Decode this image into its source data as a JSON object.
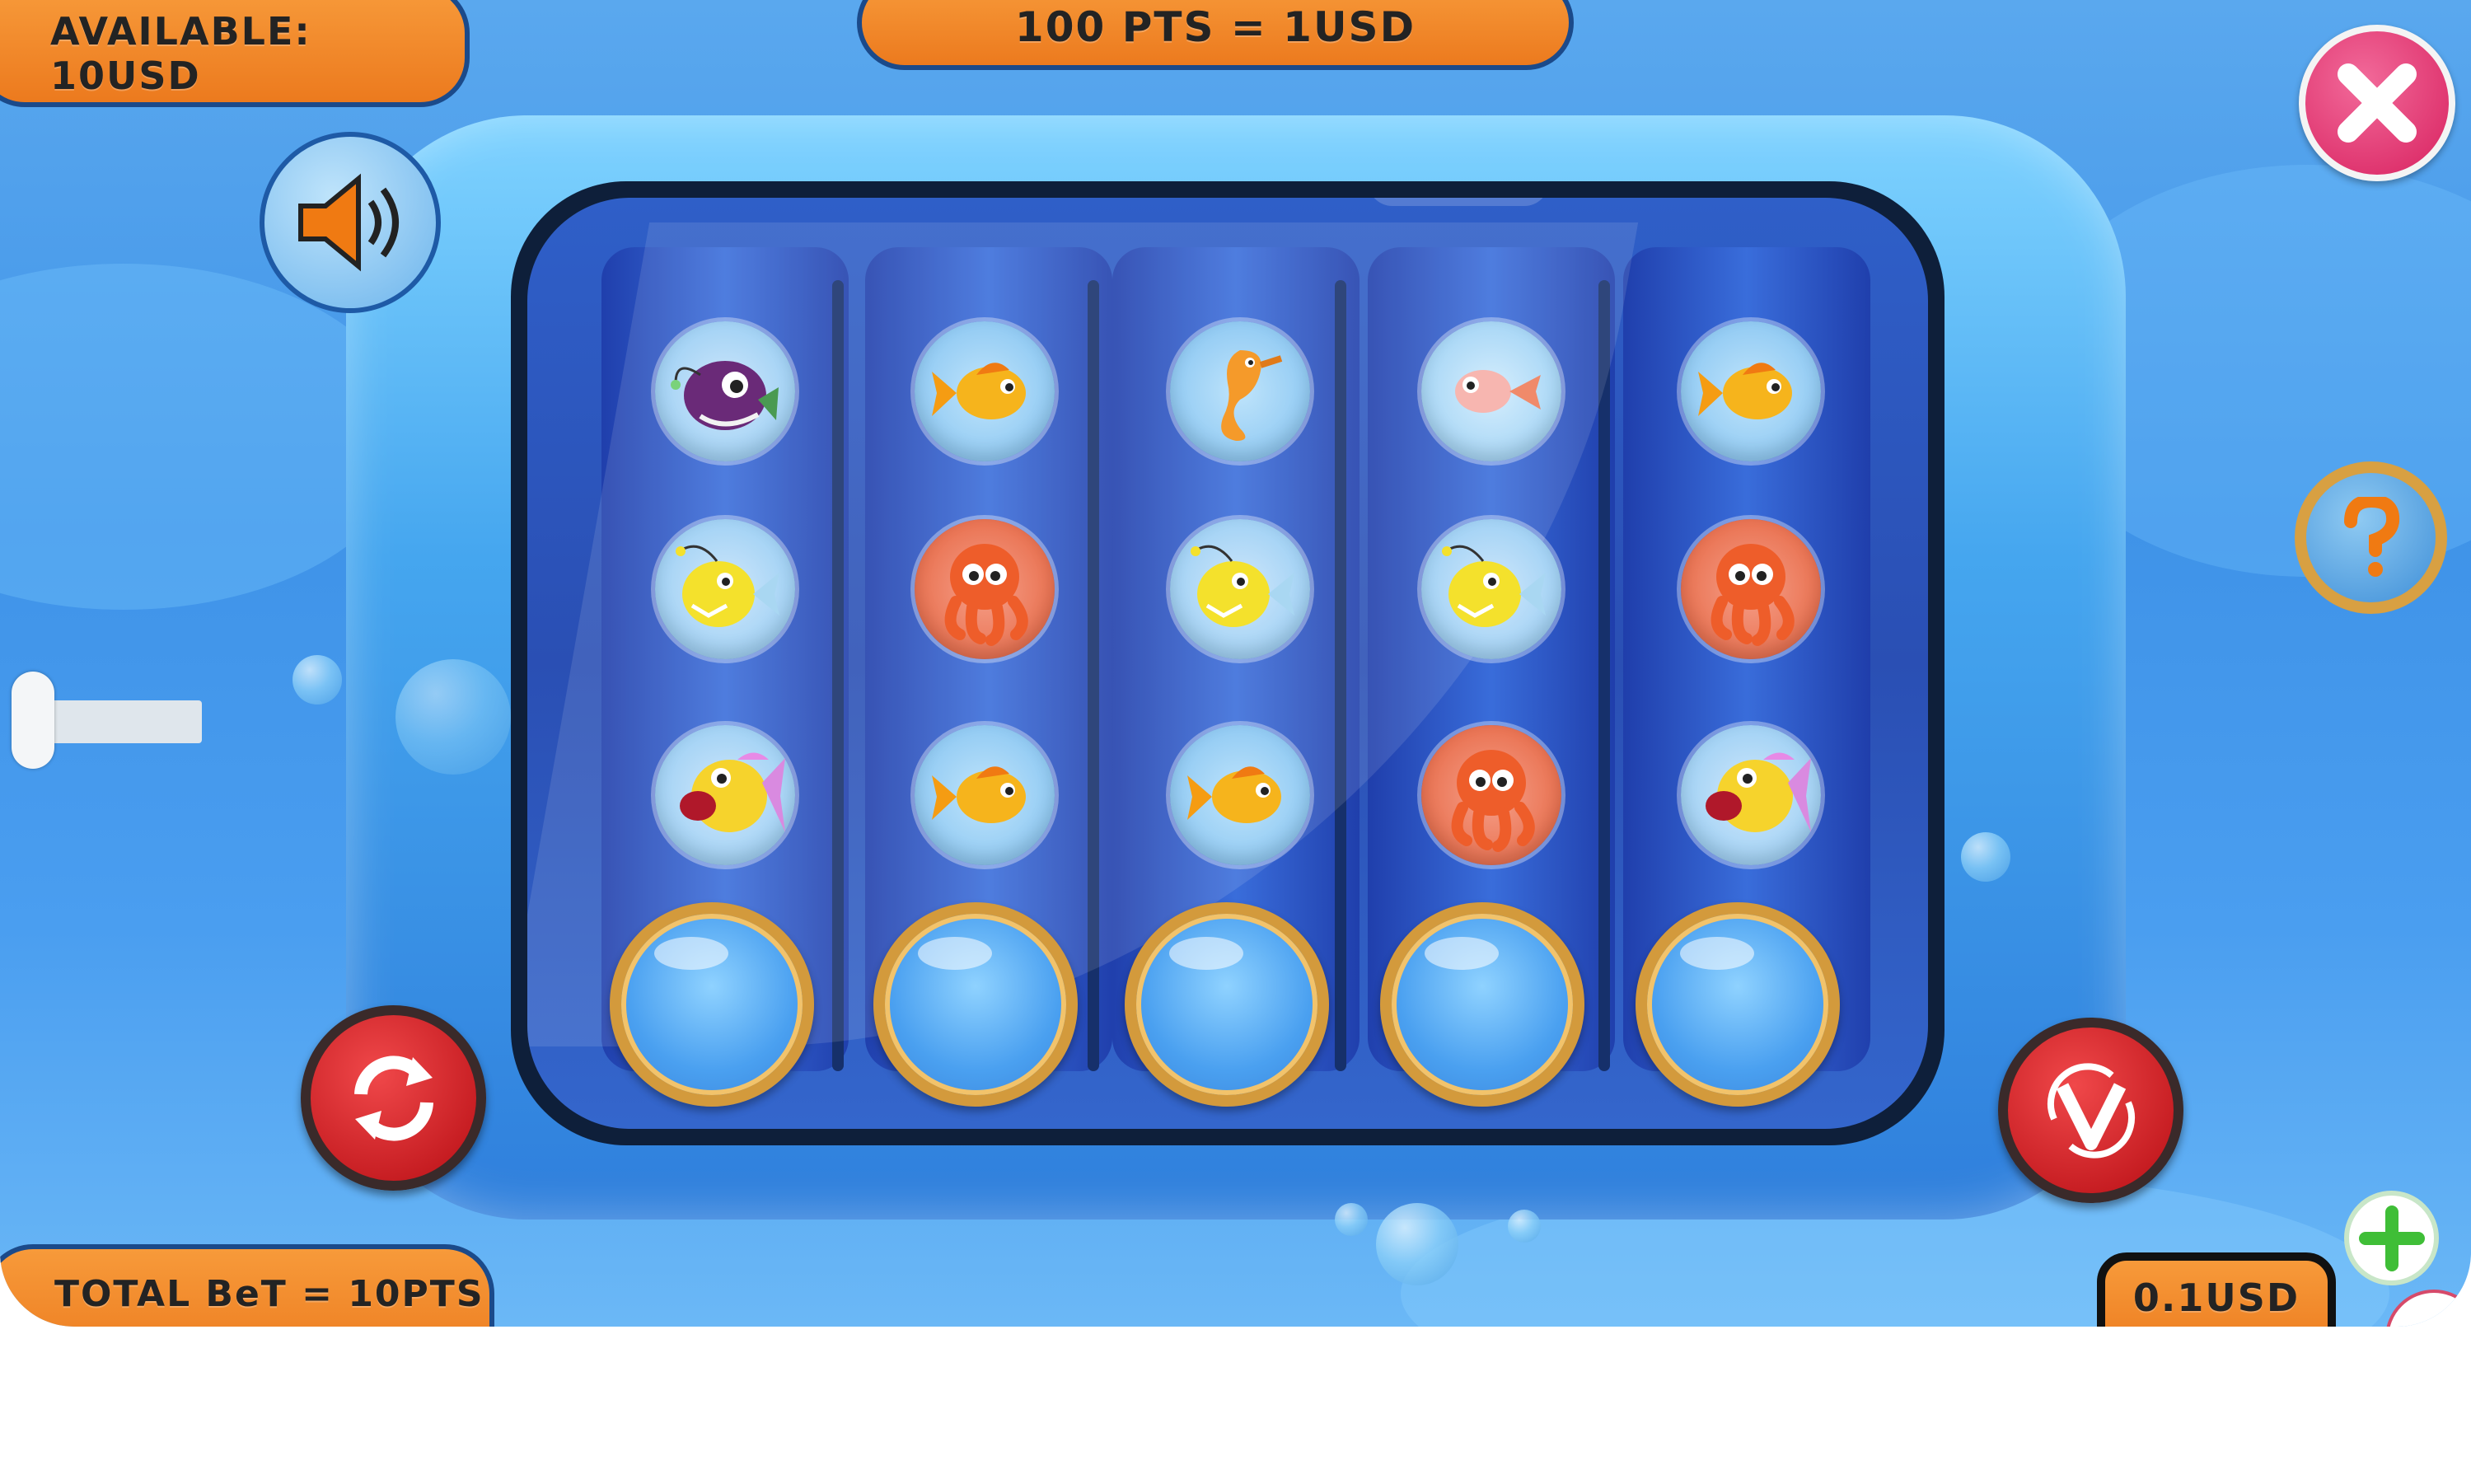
{
  "header": {
    "available": "AVAILABLE: 10USD",
    "rate": "100 PTS = 1USD"
  },
  "footer": {
    "total_bet": "TOTAL BeT = 10PTS",
    "win_amount": "0.1USD"
  },
  "icons": {
    "close": "close-icon",
    "sound": "speaker-icon",
    "help": "question-icon",
    "spin": "refresh-icon",
    "auto": "autoplay-icon",
    "add": "plus-icon"
  },
  "colors": {
    "accent_orange": "#ec7a1e",
    "close_pink": "#d8215f",
    "spin_red": "#c8141c",
    "plus_green": "#3fbe37"
  },
  "reels": [
    [
      "anglerfish-purple",
      "anglerfish-yellow",
      "bigmouth-fish"
    ],
    [
      "goldfish",
      "octopus",
      "goldfish"
    ],
    [
      "seahorse",
      "anglerfish-yellow",
      "goldfish"
    ],
    [
      "pink-fish",
      "anglerfish-yellow",
      "octopus"
    ],
    [
      "goldfish",
      "octopus",
      "bigmouth-fish"
    ]
  ]
}
